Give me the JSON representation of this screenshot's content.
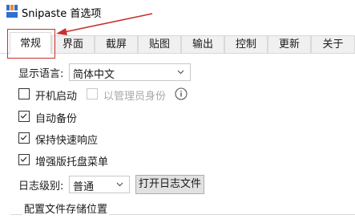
{
  "window": {
    "title": "Snipaste 首选项",
    "icon": "snipaste-logo-icon",
    "colors": {
      "logo_blue": "#2f6fd6",
      "logo_orange": "#f08a24",
      "annotation_red": "#c9302c"
    }
  },
  "tabs": [
    {
      "label": "常规",
      "active": true
    },
    {
      "label": "界面",
      "active": false
    },
    {
      "label": "截屏",
      "active": false
    },
    {
      "label": "贴图",
      "active": false
    },
    {
      "label": "输出",
      "active": false
    },
    {
      "label": "控制",
      "active": false
    },
    {
      "label": "更新",
      "active": false
    },
    {
      "label": "关于",
      "active": false
    }
  ],
  "general": {
    "language_label": "显示语言:",
    "language_value": "简体中文",
    "startup_label": "开机启动",
    "startup_checked": false,
    "run_as_admin_label": "以管理员身份",
    "run_as_admin_checked": false,
    "run_as_admin_enabled": false,
    "info_icon": "info-circle-icon",
    "auto_backup_label": "自动备份",
    "auto_backup_checked": true,
    "keep_responsive_label": "保持快速响应",
    "keep_responsive_checked": true,
    "enhanced_tray_label": "增强版托盘菜单",
    "enhanced_tray_checked": true,
    "log_level_label": "日志级别:",
    "log_level_value": "普通",
    "open_log_button": "打开日志文件",
    "config_storage_group": "配置文件存储位置"
  }
}
